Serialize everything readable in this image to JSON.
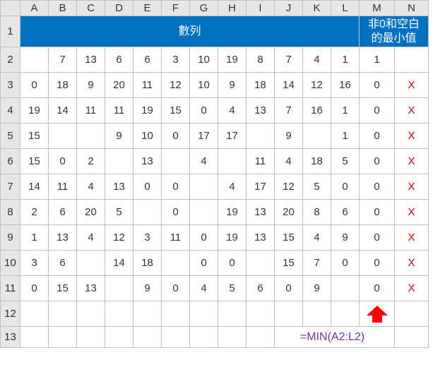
{
  "columns": [
    "A",
    "B",
    "C",
    "D",
    "E",
    "F",
    "G",
    "H",
    "I",
    "J",
    "K",
    "L",
    "M",
    "N"
  ],
  "rows": [
    "1",
    "2",
    "3",
    "4",
    "5",
    "6",
    "7",
    "8",
    "9",
    "10",
    "11",
    "12",
    "13"
  ],
  "header": {
    "left": "數列",
    "right_line1": "非0和空白",
    "right_line2": "的最小值"
  },
  "grid": [
    [
      "",
      "7",
      "13",
      "6",
      "6",
      "3",
      "10",
      "19",
      "8",
      "7",
      "4",
      "1",
      "1",
      ""
    ],
    [
      "0",
      "18",
      "9",
      "20",
      "11",
      "12",
      "10",
      "9",
      "18",
      "14",
      "12",
      "16",
      "0",
      "X"
    ],
    [
      "19",
      "14",
      "11",
      "11",
      "19",
      "15",
      "0",
      "4",
      "13",
      "7",
      "16",
      "1",
      "0",
      "X"
    ],
    [
      "15",
      "",
      "",
      "9",
      "10",
      "0",
      "17",
      "17",
      "",
      "9",
      "",
      "1",
      "0",
      "X"
    ],
    [
      "15",
      "0",
      "2",
      "",
      "13",
      "",
      "4",
      "",
      "11",
      "4",
      "18",
      "5",
      "0",
      "X"
    ],
    [
      "14",
      "11",
      "4",
      "13",
      "0",
      "0",
      "",
      "4",
      "17",
      "12",
      "5",
      "0",
      "0",
      "X"
    ],
    [
      "2",
      "6",
      "20",
      "5",
      "",
      "0",
      "",
      "19",
      "13",
      "20",
      "8",
      "6",
      "0",
      "X"
    ],
    [
      "1",
      "13",
      "4",
      "12",
      "3",
      "11",
      "0",
      "19",
      "13",
      "15",
      "4",
      "9",
      "0",
      "X"
    ],
    [
      "3",
      "6",
      "",
      "14",
      "18",
      "",
      "0",
      "0",
      "",
      "15",
      "7",
      "0",
      "0",
      "X"
    ],
    [
      "0",
      "15",
      "13",
      "",
      "9",
      "0",
      "4",
      "5",
      "6",
      "0",
      "9",
      "",
      "0",
      "X"
    ]
  ],
  "formula": "=MIN(A2:L2)",
  "icons": {
    "arrow": "up-arrow-icon"
  },
  "colors": {
    "blue": "#0070c0",
    "red": "#c00000",
    "purple": "#7030a0",
    "arrow": "#ff0000"
  },
  "chart_data": {
    "type": "table",
    "title": "數列 / 非0和空白的最小值",
    "columns": [
      "A",
      "B",
      "C",
      "D",
      "E",
      "F",
      "G",
      "H",
      "I",
      "J",
      "K",
      "L",
      "M",
      "N"
    ],
    "rows_index": [
      2,
      3,
      4,
      5,
      6,
      7,
      8,
      9,
      10,
      11
    ],
    "data": [
      [
        null,
        7,
        13,
        6,
        6,
        3,
        10,
        19,
        8,
        7,
        4,
        1,
        1,
        null
      ],
      [
        0,
        18,
        9,
        20,
        11,
        12,
        10,
        9,
        18,
        14,
        12,
        16,
        0,
        "X"
      ],
      [
        19,
        14,
        11,
        11,
        19,
        15,
        0,
        4,
        13,
        7,
        16,
        1,
        0,
        "X"
      ],
      [
        15,
        null,
        null,
        9,
        10,
        0,
        17,
        17,
        null,
        9,
        null,
        1,
        0,
        "X"
      ],
      [
        15,
        0,
        2,
        null,
        13,
        null,
        4,
        null,
        11,
        4,
        18,
        5,
        0,
        "X"
      ],
      [
        14,
        11,
        4,
        13,
        0,
        0,
        null,
        4,
        17,
        12,
        5,
        0,
        0,
        "X"
      ],
      [
        2,
        6,
        20,
        5,
        null,
        0,
        null,
        19,
        13,
        20,
        8,
        6,
        0,
        "X"
      ],
      [
        1,
        13,
        4,
        12,
        3,
        11,
        0,
        19,
        13,
        15,
        4,
        9,
        0,
        "X"
      ],
      [
        3,
        6,
        null,
        14,
        18,
        null,
        0,
        0,
        null,
        15,
        7,
        0,
        0,
        "X"
      ],
      [
        0,
        15,
        13,
        null,
        9,
        0,
        4,
        5,
        6,
        0,
        9,
        null,
        0,
        "X"
      ]
    ],
    "formula_cell": {
      "row": 13,
      "text": "=MIN(A2:L2)"
    }
  }
}
